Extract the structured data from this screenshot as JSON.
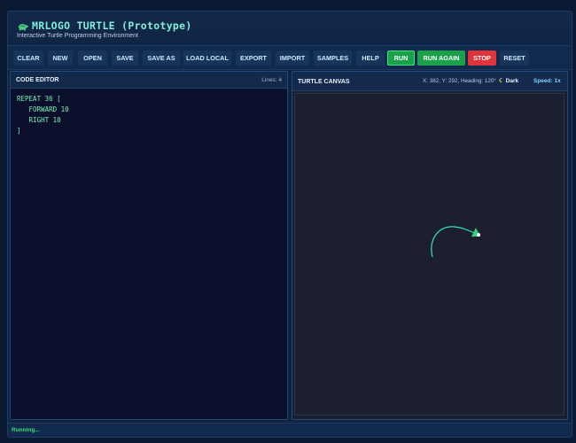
{
  "header": {
    "title": "MRLOGO TURTLE (Prototype)",
    "subtitle": "Interactive Turtle Programming Environment",
    "logo_icon": "turtle-icon"
  },
  "toolbar": {
    "clear": "CLEAR",
    "new": "NEW",
    "open": "OPEN",
    "save": "SAVE",
    "save_as": "SAVE AS",
    "load_local": "LOAD LOCAL",
    "export": "EXPORT",
    "import": "IMPORT",
    "samples": "SAMPLES",
    "help": "HELP",
    "run": "RUN",
    "run_again": "RUN AGAIN",
    "stop": "STOP",
    "reset": "RESET"
  },
  "editor": {
    "title": "CODE EDITOR",
    "lines_label": "Lines: 4",
    "code": [
      "REPEAT 36 [",
      "   FORWARD 10",
      "   RIGHT 10",
      "]"
    ]
  },
  "canvas": {
    "title": "TURTLE CANVAS",
    "coords": "X: 382, Y: 292, Heading: 120°",
    "theme_icon": "moon-icon",
    "theme_label": "Dark",
    "speed_label": "Speed: 1x",
    "colors": {
      "pen": "#3de0c0",
      "turtle": "#2fd47a",
      "background": "#1c1f30"
    }
  },
  "status": {
    "text": "Running..."
  },
  "colors": {
    "accent": "#7ff0dc",
    "run": "#1aa14a",
    "stop": "#e0343d"
  }
}
